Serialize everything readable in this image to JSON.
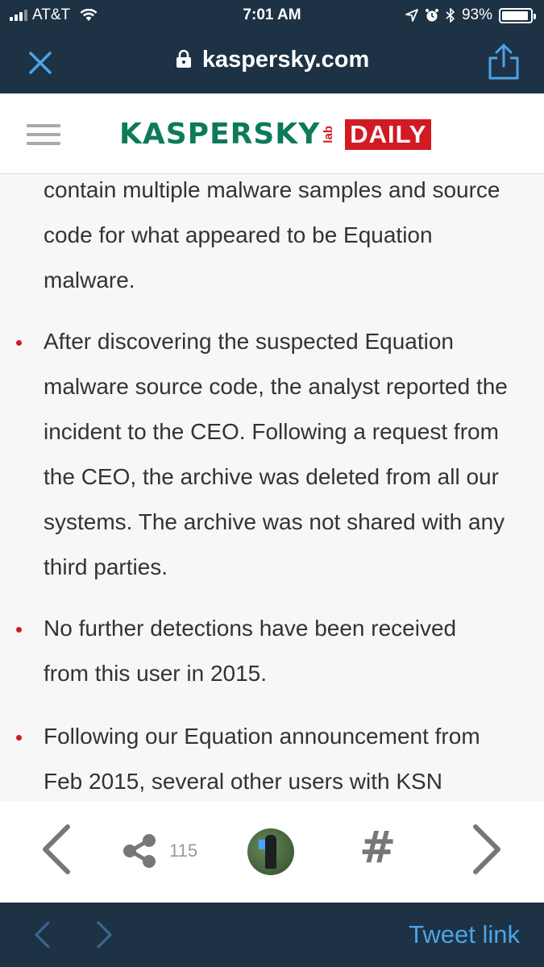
{
  "status_bar": {
    "carrier": "AT&T",
    "time": "7:01 AM",
    "battery": "93%",
    "battery_level": 0.93
  },
  "browser": {
    "url": "kaspersky.com",
    "close_icon": "close-icon",
    "share_icon": "share-icon",
    "lock_icon": "lock-icon"
  },
  "site": {
    "logo_text": "KASPERSKY",
    "logo_lab": "lab",
    "logo_daily": "DAILY"
  },
  "article": {
    "lines": [
      "contain multiple malware samples and source",
      "code for what appeared to be Equation",
      "malware.",
      "After discovering the suspected Equation",
      "malware source code, the analyst reported the",
      "incident to the CEO. Following a request from",
      "the CEO, the archive was deleted from all our",
      "systems. The archive was not shared with any",
      "third parties.",
      "No further detections have been received",
      "from this user in 2015.",
      "Following our Equation announcement from",
      "Feb 2015, several other users with KSN"
    ]
  },
  "article_nav": {
    "share_count": "115"
  },
  "twitter_bar": {
    "tweet_link": "Tweet link"
  },
  "colors": {
    "dark_bar": "#1e3245",
    "brand_green": "#0d7a5a",
    "brand_red": "#d11a22",
    "link_blue": "#4aa4e8"
  }
}
